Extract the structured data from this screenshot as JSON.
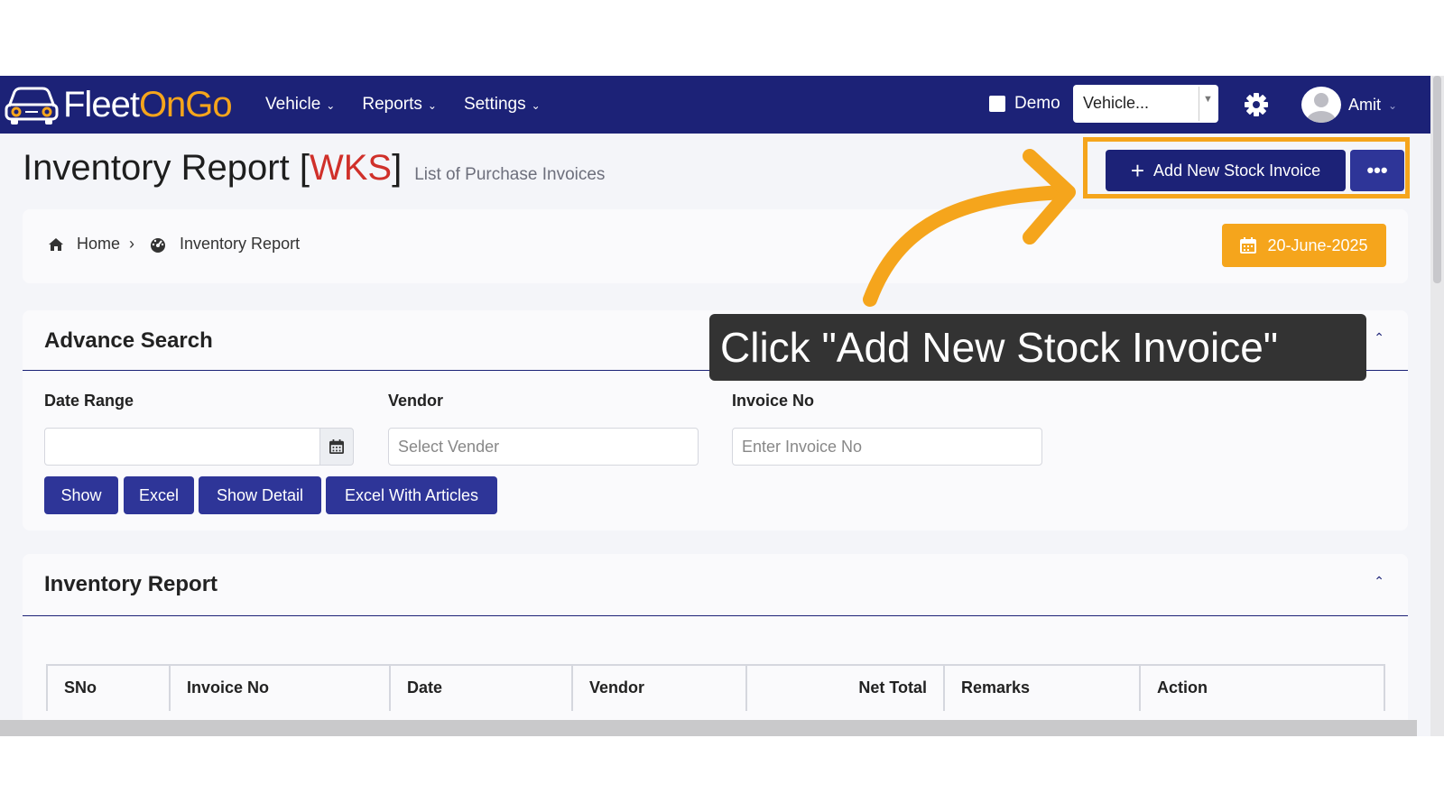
{
  "nav": {
    "logo_part1": "Fleet",
    "logo_part2": "On",
    "logo_part3": "Go",
    "menu": [
      {
        "label": "Vehicle"
      },
      {
        "label": "Reports"
      },
      {
        "label": "Settings"
      }
    ],
    "demo_label": "Demo",
    "vehicle_select_value": "Vehicle...",
    "user_name": "Amit"
  },
  "header": {
    "title": "Inventory Report",
    "code": "WKS",
    "subtitle": "List of Purchase Invoices",
    "add_button": "Add New Stock Invoice",
    "more_button": "•••"
  },
  "breadcrumb": {
    "home": "Home",
    "current": "Inventory Report",
    "date": "20-June-2025"
  },
  "search": {
    "heading": "Advance Search",
    "date_range_label": "Date Range",
    "date_range_value": "",
    "vendor_label": "Vendor",
    "vendor_placeholder": "Select Vender",
    "invoice_label": "Invoice No",
    "invoice_placeholder": "Enter Invoice No",
    "buttons": [
      "Show",
      "Excel",
      "Show Detail",
      "Excel With Articles"
    ]
  },
  "report": {
    "heading": "Inventory Report",
    "columns": [
      "SNo",
      "Invoice No",
      "Date",
      "Vendor",
      "Net Total",
      "Remarks",
      "Action"
    ]
  },
  "annotation": {
    "text": "Click \"Add New Stock Invoice\"",
    "highlight_color": "#f5a51c"
  },
  "colors": {
    "navy": "#1c2277",
    "button": "#2e3598",
    "accent": "#f5a51c",
    "code_red": "#d0302a"
  }
}
